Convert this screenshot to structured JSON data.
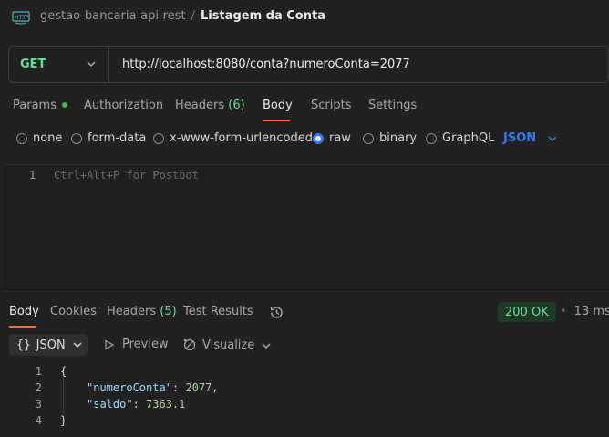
{
  "breadcrumb": {
    "collection": "gestao-bancaria-api-rest",
    "separator": "/",
    "request": "Listagem da Conta"
  },
  "request": {
    "method": "GET",
    "url": "http://localhost:8080/conta?numeroConta=2077"
  },
  "request_tabs": {
    "params": "Params",
    "authorization": "Authorization",
    "headers": "Headers",
    "headers_count": "(6)",
    "body": "Body",
    "scripts": "Scripts",
    "settings": "Settings",
    "active": "Body"
  },
  "body_types": {
    "none": "none",
    "form_data": "form-data",
    "urlencoded": "x-www-form-urlencoded",
    "raw": "raw",
    "binary": "binary",
    "graphql": "GraphQL",
    "selected": "raw",
    "raw_format": "JSON"
  },
  "editor": {
    "line_number": "1",
    "placeholder": "Ctrl+Alt+P for Postbot"
  },
  "response_tabs": {
    "body": "Body",
    "cookies": "Cookies",
    "headers": "Headers",
    "headers_count": "(5)",
    "test_results": "Test Results",
    "active": "Body"
  },
  "response_status": {
    "status": "200 OK",
    "time": "13 ms"
  },
  "response_toolbar": {
    "format_label": "JSON",
    "preview": "Preview",
    "visualize": "Visualize"
  },
  "response_body": {
    "lines": [
      {
        "n": "1",
        "text": "{"
      },
      {
        "n": "2",
        "key": "\"numeroConta\"",
        "value": "2077",
        "trail": ","
      },
      {
        "n": "3",
        "key": "\"saldo\"",
        "value": "7363.1",
        "trail": ""
      },
      {
        "n": "4",
        "text": "}"
      }
    ]
  },
  "colors": {
    "background": "#212121",
    "method_get": "#6bdd9a",
    "accent_orange": "#ff6c37",
    "accent_blue": "#2f7cf6",
    "status_ok_bg": "#1c3a26"
  }
}
